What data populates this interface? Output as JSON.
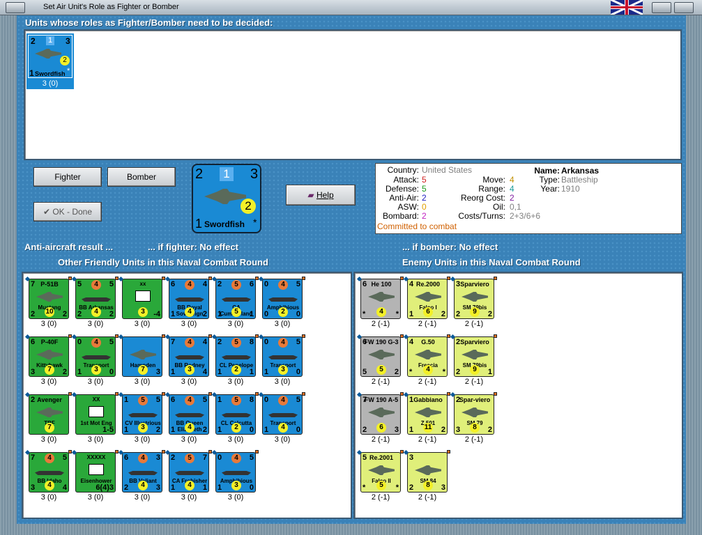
{
  "window": {
    "title": "Set Air Unit's Role as Fighter or Bomber"
  },
  "sections": {
    "undecided": "Units whose roles as Fighter/Bomber need to be decided:",
    "friendly": "Other Friendly Units in this Naval Combat Round",
    "enemy": "Enemy Units in this Naval Combat Round"
  },
  "undecided_unit": {
    "name": "Swordfish",
    "tl": "2",
    "tm": "1",
    "tr": "3",
    "bl": "1",
    "val": "2",
    "star": "*",
    "caption": "3 (0)"
  },
  "buttons": {
    "fighter": "Fighter",
    "bomber": "Bomber",
    "ok": "OK - Done",
    "help": "Help"
  },
  "big_unit": {
    "tl": "2",
    "tm": "1",
    "tr": "3",
    "bl": "1",
    "val": "2",
    "name": "Swordfish",
    "star": "*"
  },
  "info": {
    "country_l": "Country:",
    "country": "United States",
    "attack_l": "Attack:",
    "attack": "5",
    "defense_l": "Defense:",
    "defense": "5",
    "antiair_l": "Anti-Air:",
    "antiair": "2",
    "asw_l": "ASW:",
    "asw": "0",
    "bombard_l": "Bombard:",
    "bombard": "2",
    "move_l": "Move:",
    "move": "4",
    "range_l": "Range:",
    "range": "4",
    "reorg_l": "Reorg Cost:",
    "reorg": "2",
    "oil_l": "Oil:",
    "oil": "0,1",
    "costs_l": "Costs/Turns:",
    "costs": "2+3/6+6",
    "name_l": "Name:",
    "name": "Arkansas",
    "type_l": "Type:",
    "type": "Battleship",
    "year_l": "Year:",
    "year": "1910",
    "status": "Committed to combat",
    "colors": {
      "attack": "#d02020",
      "defense": "#1a9a1a",
      "antiair": "#2020c0",
      "asw": "#e0a000",
      "bombard": "#c020c0",
      "move": "#c09000",
      "range": "#1a9a9a",
      "reorg": "#8020a0",
      "status": "#d06000",
      "gray": "#808080"
    }
  },
  "results": {
    "aa": "Anti-aircraft result ...",
    "fighter": "... if fighter:  No effect",
    "bomber": "... if bomber:  No effect"
  },
  "friendly_units": [
    {
      "kind": "air",
      "color": "green",
      "tl": "7",
      "title": "P-51B",
      "sub": "Mustang",
      "bl": "2",
      "yc": "10",
      "br": "2",
      "cap": "3 (0)"
    },
    {
      "kind": "ship",
      "color": "green",
      "tl": "5",
      "oc": "4",
      "tr": "5",
      "sub": "BB Arkansas",
      "bl": "2",
      "yc": "4",
      "br": "2",
      "cap": "3 (0)"
    },
    {
      "kind": "hq",
      "color": "green",
      "tl": "",
      "title": "xx",
      "bl": "",
      "yc": "3",
      "br": "-4",
      "cap": "3 (0)"
    },
    {
      "kind": "ship",
      "color": "blue",
      "tl": "6",
      "oc": "4",
      "tr": "4",
      "sub": "BB Royal Sovereign",
      "bl": "1",
      "yc": "4",
      "br": "2",
      "cap": "3 (0)"
    },
    {
      "kind": "ship",
      "color": "blue",
      "tl": "2",
      "oc": "5",
      "tr": "6",
      "sub": "CA Cumberland",
      "bl": "1",
      "yc": "5",
      "br": "1",
      "cap": "3 (0)"
    },
    {
      "kind": "ship",
      "color": "blue",
      "tl": "0",
      "oc": "4",
      "tr": "5",
      "sub": "Amphibious",
      "bl": "0",
      "yc": "2",
      "br": "0",
      "cap": "3 (0)"
    },
    {
      "kind": "air",
      "color": "green",
      "tl": "6",
      "title": "P-40F",
      "sub": "Kittyhawk",
      "bl": "3",
      "yc": "7",
      "br": "2",
      "cap": "3 (0)"
    },
    {
      "kind": "ship",
      "color": "green",
      "tl": "0",
      "oc": "4",
      "tr": "5",
      "sub": "Transport",
      "bl": "1",
      "yc": "3",
      "br": "0",
      "cap": "3 (0)"
    },
    {
      "kind": "air",
      "color": "blue",
      "tl": "",
      "title": "",
      "sub": "Hampden",
      "bl": "",
      "yc": "7",
      "br": "3",
      "cap": "3 (0)"
    },
    {
      "kind": "ship",
      "color": "blue",
      "tl": "7",
      "oc": "4",
      "tr": "4",
      "sub": "BB Rodney",
      "bl": "1",
      "yc": "3",
      "br": "4",
      "cap": "3 (0)"
    },
    {
      "kind": "ship",
      "color": "blue",
      "tl": "2",
      "oc": "5",
      "tr": "8",
      "sub": "CL Penelope",
      "bl": "1",
      "yc": "2",
      "br": "1",
      "cap": "3 (0)"
    },
    {
      "kind": "ship",
      "color": "blue",
      "tl": "0",
      "oc": "4",
      "tr": "5",
      "sub": "Transport",
      "bl": "1",
      "yc": "3",
      "br": "0",
      "cap": "3 (0)"
    },
    {
      "kind": "air",
      "color": "green",
      "tl": "2",
      "title": "Avenger",
      "sub": "TBF",
      "bl": "",
      "yc": "7",
      "br": "",
      "cap": "3 (0)"
    },
    {
      "kind": "hq",
      "color": "green",
      "tl": "",
      "title": "XX",
      "sub": "1st Mot Eng",
      "bl": "",
      "yc": "",
      "br": "1-5",
      "cap": "3 (0)"
    },
    {
      "kind": "ship",
      "color": "blue",
      "tl": "1",
      "oc": "5",
      "tr": "5",
      "sub": "CV Illustrious",
      "bl": "1",
      "yc": "3",
      "br": "2",
      "cap": "3 (0)"
    },
    {
      "kind": "ship",
      "color": "blue",
      "tl": "6",
      "oc": "4",
      "tr": "5",
      "sub": "BB Queen Elizabeth",
      "bl": "1",
      "yc": "4",
      "br": "2",
      "cap": "3 (0)"
    },
    {
      "kind": "ship",
      "color": "blue",
      "tl": "1",
      "oc": "5",
      "tr": "8",
      "sub": "CL Calcutta",
      "bl": "1",
      "yc": "2",
      "br": "0",
      "cap": "3 (0)"
    },
    {
      "kind": "ship",
      "color": "blue",
      "tl": "0",
      "oc": "4",
      "tr": "5",
      "sub": "Transport",
      "bl": "1",
      "yc": "4",
      "br": "0",
      "cap": "3 (0)"
    },
    {
      "kind": "ship",
      "color": "green",
      "tl": "7",
      "oc": "4",
      "tr": "5",
      "sub": "BB Idaho",
      "bl": "3",
      "yc": "4",
      "br": "4",
      "cap": "3 (0)"
    },
    {
      "kind": "hq",
      "color": "green",
      "tl": "",
      "title": "XXXXX",
      "sub": "Eisenhower",
      "bl": "",
      "yc": "",
      "br": "6(4)3",
      "cap": "3 (0)"
    },
    {
      "kind": "ship",
      "color": "blue",
      "tl": "6",
      "oc": "4",
      "tr": "3",
      "sub": "BB Valiant",
      "bl": "2",
      "yc": "4",
      "br": "3",
      "cap": "3 (0)"
    },
    {
      "kind": "ship",
      "color": "blue",
      "tl": "2",
      "oc": "5",
      "tr": "7",
      "sub": "CA Frobisher",
      "bl": "1",
      "yc": "4",
      "br": "1",
      "cap": "3 (0)"
    },
    {
      "kind": "ship",
      "color": "blue",
      "tl": "0",
      "oc": "4",
      "tr": "5",
      "sub": "Amphibious",
      "bl": "1",
      "yc": "3",
      "br": "0",
      "cap": "3 (0)"
    }
  ],
  "enemy_units": [
    {
      "kind": "air",
      "color": "gray",
      "tl": "6",
      "title": "He 100",
      "sub": "",
      "bl": "*",
      "yc": "4",
      "br": "*",
      "cap": "2 (-1)"
    },
    {
      "kind": "air",
      "color": "yel",
      "tl": "4",
      "title": "Re.2000",
      "sub": "Falco I",
      "bl": "1",
      "yc": "6",
      "br": "2",
      "cap": "2 (-1)"
    },
    {
      "kind": "air",
      "color": "yel",
      "tl": "3",
      "title": "Sparviero",
      "sub": "SM.79bis",
      "bl": "2",
      "yc": "9",
      "br": "2",
      "cap": "2 (-1)"
    },
    {
      "kind": "air",
      "color": "gray",
      "tl": "6",
      "title": "FW 190 G-3",
      "sub": "",
      "bl": "5",
      "yc": "5",
      "br": "2",
      "cap": "2 (-1)"
    },
    {
      "kind": "air",
      "color": "yel",
      "tl": "4",
      "title": "G.50",
      "sub": "Freccia",
      "bl": "*",
      "yc": "4",
      "br": "*",
      "cap": "2 (-1)"
    },
    {
      "kind": "air",
      "color": "yel",
      "tl": "2",
      "title": "Sparviero",
      "sub": "SM.79bis",
      "bl": "2",
      "yc": "9",
      "br": "1",
      "cap": "2 (-1)"
    },
    {
      "kind": "air",
      "color": "gray",
      "tl": "7",
      "title": "FW 190 A-5",
      "sub": "",
      "bl": "2",
      "yc": "6",
      "br": "3",
      "cap": "2 (-1)"
    },
    {
      "kind": "air",
      "color": "yel",
      "tl": "1",
      "title": "Gabbiano",
      "sub": "Z.501",
      "bl": "1",
      "yc": "11",
      "br": "2",
      "cap": "2 (-1)"
    },
    {
      "kind": "air",
      "color": "yel",
      "tl": "2",
      "title": "Spar-viero",
      "sub": "SM.79",
      "bl": "3",
      "yc": "8",
      "br": "2",
      "cap": "2 (-1)"
    },
    {
      "kind": "air",
      "color": "yel",
      "tl": "5",
      "title": "Re.2001",
      "sub": "Falco II",
      "bl": "*",
      "yc": "5",
      "br": "*",
      "cap": "2 (-1)"
    },
    {
      "kind": "air",
      "color": "yel",
      "tl": "3",
      "title": "",
      "sub": "SM.84",
      "bl": "2",
      "yc": "8",
      "br": "3",
      "cap": "2 (-1)"
    }
  ]
}
